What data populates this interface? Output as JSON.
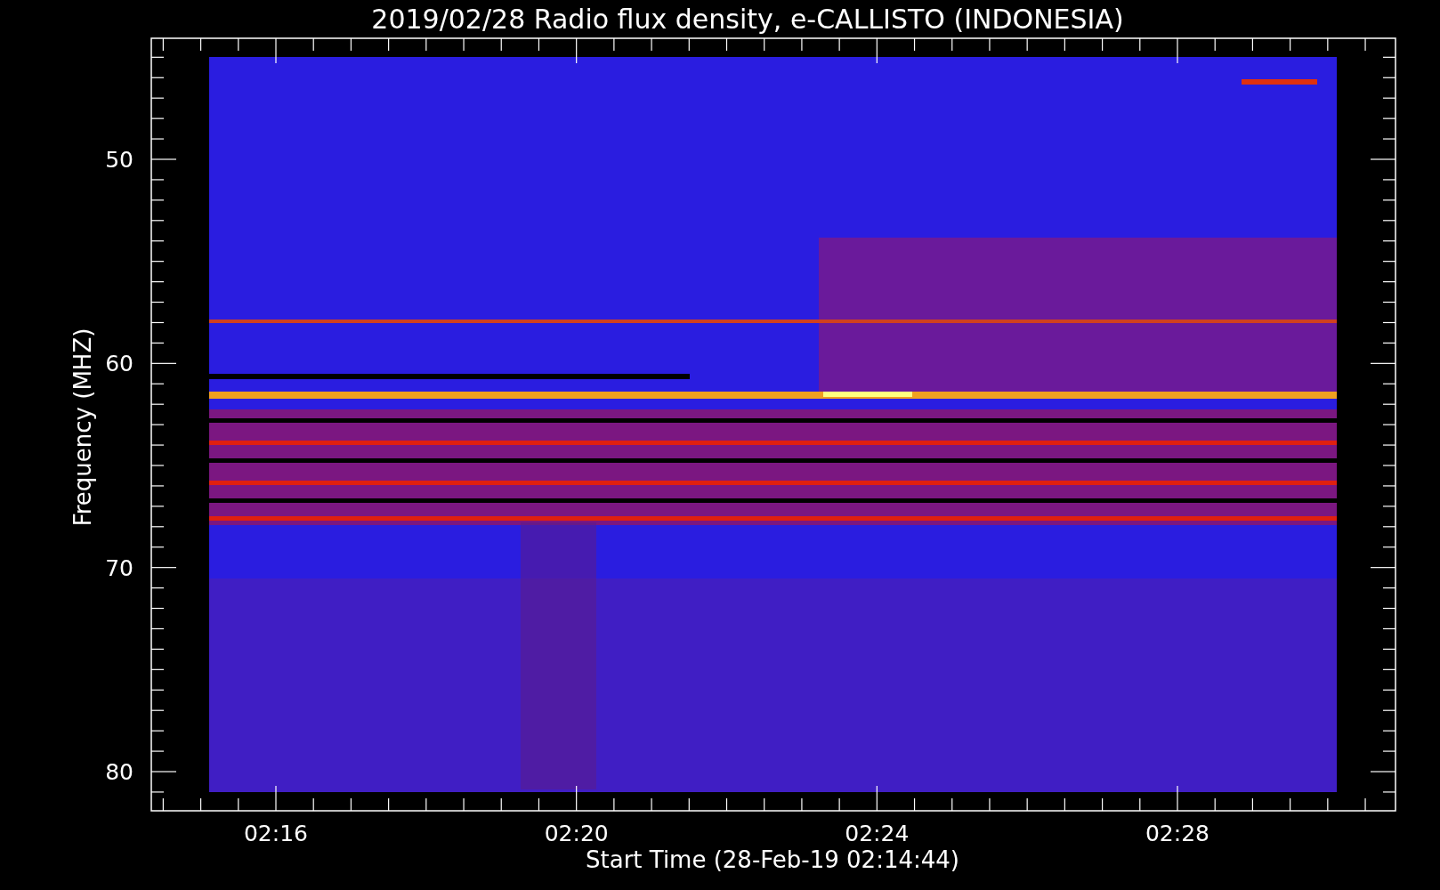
{
  "title": "2019/02/28  Radio flux density, e-CALLISTO (INDONESIA)",
  "y_axis": {
    "label": "Frequency (MHZ)",
    "ticks": [
      "50",
      "60",
      "70",
      "80"
    ]
  },
  "x_axis": {
    "label": "Start Time (28-Feb-19 02:14:44)",
    "ticks": [
      "02:16",
      "02:20",
      "02:24",
      "02:28"
    ]
  }
}
